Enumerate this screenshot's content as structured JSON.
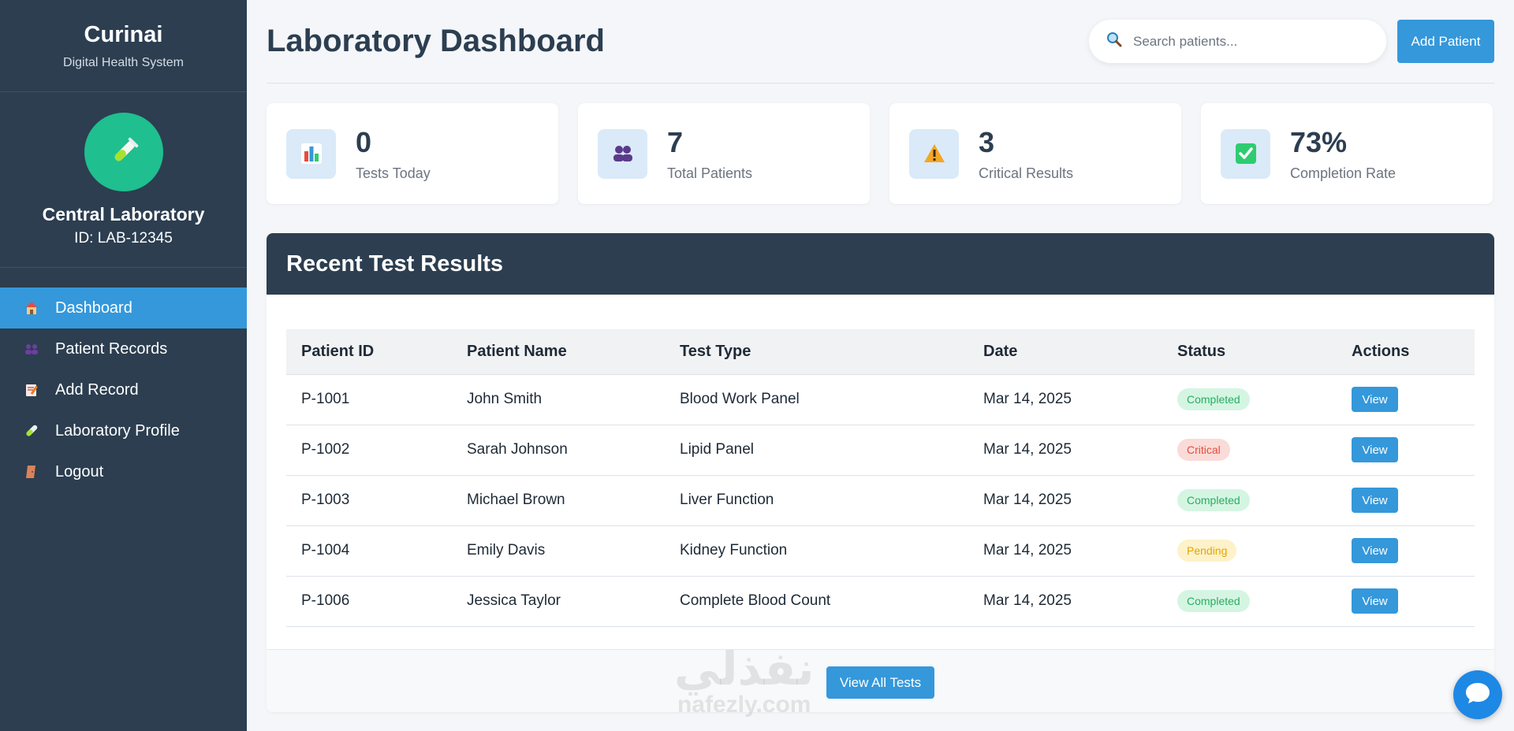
{
  "sidebar": {
    "brand": "Curinai",
    "subtitle": "Digital Health System",
    "lab_name": "Central Laboratory",
    "lab_id": "ID: LAB-12345",
    "nav": [
      {
        "label": "Dashboard",
        "icon": "house-icon",
        "active": true
      },
      {
        "label": "Patient Records",
        "icon": "users-icon",
        "active": false
      },
      {
        "label": "Add Record",
        "icon": "memo-icon",
        "active": false
      },
      {
        "label": "Laboratory Profile",
        "icon": "test-tube-icon",
        "active": false
      },
      {
        "label": "Logout",
        "icon": "door-icon",
        "active": false
      }
    ]
  },
  "header": {
    "title": "Laboratory Dashboard",
    "search_placeholder": "Search patients...",
    "add_label": "Add Patient"
  },
  "stats": [
    {
      "value": "0",
      "label": "Tests Today",
      "icon": "bar-chart-icon"
    },
    {
      "value": "7",
      "label": "Total Patients",
      "icon": "users-icon"
    },
    {
      "value": "3",
      "label": "Critical Results",
      "icon": "warning-icon"
    },
    {
      "value": "73%",
      "label": "Completion Rate",
      "icon": "check-box-icon"
    }
  ],
  "results": {
    "title": "Recent Test Results",
    "columns": [
      "Patient ID",
      "Patient Name",
      "Test Type",
      "Date",
      "Status",
      "Actions"
    ],
    "rows": [
      {
        "id": "P-1001",
        "name": "John Smith",
        "test": "Blood Work Panel",
        "date": "Mar 14, 2025",
        "status": "Completed",
        "action": "View"
      },
      {
        "id": "P-1002",
        "name": "Sarah Johnson",
        "test": "Lipid Panel",
        "date": "Mar 14, 2025",
        "status": "Critical",
        "action": "View"
      },
      {
        "id": "P-1003",
        "name": "Michael Brown",
        "test": "Liver Function",
        "date": "Mar 14, 2025",
        "status": "Completed",
        "action": "View"
      },
      {
        "id": "P-1004",
        "name": "Emily Davis",
        "test": "Kidney Function",
        "date": "Mar 14, 2025",
        "status": "Pending",
        "action": "View"
      },
      {
        "id": "P-1006",
        "name": "Jessica Taylor",
        "test": "Complete Blood Count",
        "date": "Mar 14, 2025",
        "status": "Completed",
        "action": "View"
      }
    ],
    "view_all": "View All Tests"
  },
  "watermark": {
    "arabic": "نفذلي",
    "latin": "nafezly.com"
  },
  "colors": {
    "sidebar": "#2c3e50",
    "accent": "#3498db",
    "completed": "#27ae60",
    "critical": "#e74c3c",
    "pending": "#e6a400"
  }
}
